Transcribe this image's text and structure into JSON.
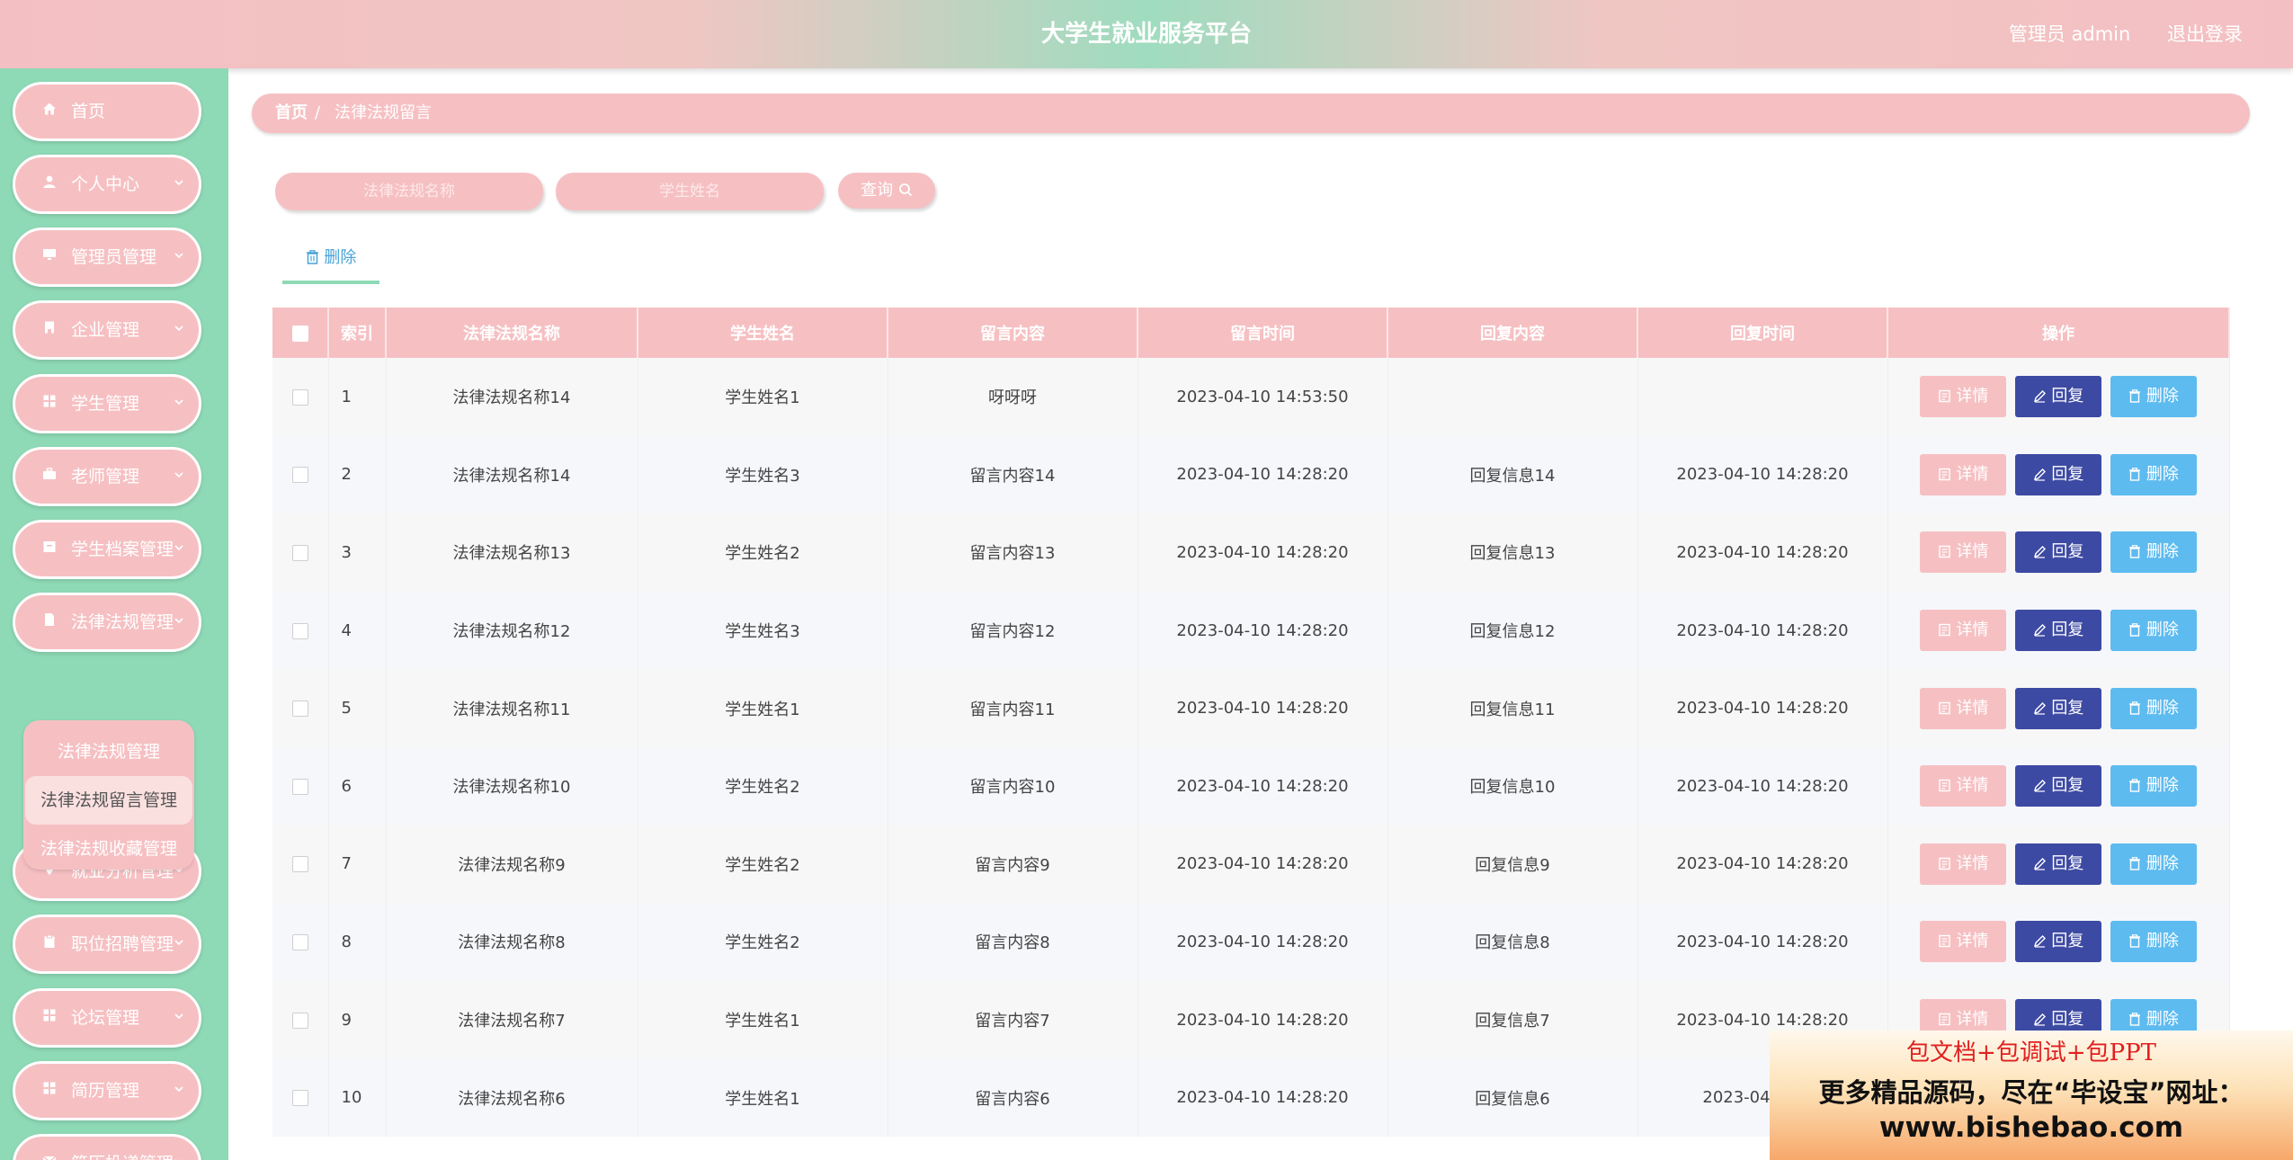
{
  "header": {
    "title": "大学生就业服务平台",
    "admin_label": "管理员 admin",
    "logout_label": "退出登录"
  },
  "sidebar": {
    "items": [
      {
        "label": "首页",
        "icon": "home-icon",
        "has_arrow": false
      },
      {
        "label": "个人中心",
        "icon": "user-icon",
        "has_arrow": true
      },
      {
        "label": "管理员管理",
        "icon": "monitor-icon",
        "has_arrow": true
      },
      {
        "label": "企业管理",
        "icon": "building-icon",
        "has_arrow": true
      },
      {
        "label": "学生管理",
        "icon": "grid-icon",
        "has_arrow": true
      },
      {
        "label": "老师管理",
        "icon": "briefcase-icon",
        "has_arrow": true
      },
      {
        "label": "学生档案管理",
        "icon": "archive-icon",
        "has_arrow": true
      },
      {
        "label": "法律法规管理",
        "icon": "document-icon",
        "has_arrow": true
      },
      {
        "label": "就业分析管理",
        "icon": "location-icon",
        "has_arrow": true
      },
      {
        "label": "职位招聘管理",
        "icon": "clipboard-icon",
        "has_arrow": true
      },
      {
        "label": "论坛管理",
        "icon": "grid-icon",
        "has_arrow": true
      },
      {
        "label": "简历管理",
        "icon": "grid-icon",
        "has_arrow": true
      },
      {
        "label": "简历投递管理",
        "icon": "mail-icon",
        "has_arrow": true
      }
    ],
    "submenu": [
      {
        "label": "法律法规管理"
      },
      {
        "label": "法律法规留言管理"
      },
      {
        "label": "法律法规收藏管理"
      }
    ]
  },
  "breadcrumb": {
    "home": "首页",
    "separator": "/",
    "current": "法律法规留言"
  },
  "search": {
    "name_placeholder": "法律法规名称",
    "student_placeholder": "学生姓名",
    "query_label": "查询"
  },
  "toolbar": {
    "delete_label": "删除"
  },
  "table": {
    "headers": [
      "索引",
      "法律法规名称",
      "学生姓名",
      "留言内容",
      "留言时间",
      "回复内容",
      "回复时间",
      "操作"
    ],
    "rows": [
      {
        "idx": "1",
        "name": "法律法规名称14",
        "student": "学生姓名1",
        "content": "呀呀呀",
        "time": "2023-04-10 14:53:50",
        "reply": "",
        "reply_time": ""
      },
      {
        "idx": "2",
        "name": "法律法规名称14",
        "student": "学生姓名3",
        "content": "留言内容14",
        "time": "2023-04-10 14:28:20",
        "reply": "回复信息14",
        "reply_time": "2023-04-10 14:28:20"
      },
      {
        "idx": "3",
        "name": "法律法规名称13",
        "student": "学生姓名2",
        "content": "留言内容13",
        "time": "2023-04-10 14:28:20",
        "reply": "回复信息13",
        "reply_time": "2023-04-10 14:28:20"
      },
      {
        "idx": "4",
        "name": "法律法规名称12",
        "student": "学生姓名3",
        "content": "留言内容12",
        "time": "2023-04-10 14:28:20",
        "reply": "回复信息12",
        "reply_time": "2023-04-10 14:28:20"
      },
      {
        "idx": "5",
        "name": "法律法规名称11",
        "student": "学生姓名1",
        "content": "留言内容11",
        "time": "2023-04-10 14:28:20",
        "reply": "回复信息11",
        "reply_time": "2023-04-10 14:28:20"
      },
      {
        "idx": "6",
        "name": "法律法规名称10",
        "student": "学生姓名2",
        "content": "留言内容10",
        "time": "2023-04-10 14:28:20",
        "reply": "回复信息10",
        "reply_time": "2023-04-10 14:28:20"
      },
      {
        "idx": "7",
        "name": "法律法规名称9",
        "student": "学生姓名2",
        "content": "留言内容9",
        "time": "2023-04-10 14:28:20",
        "reply": "回复信息9",
        "reply_time": "2023-04-10 14:28:20"
      },
      {
        "idx": "8",
        "name": "法律法规名称8",
        "student": "学生姓名2",
        "content": "留言内容8",
        "time": "2023-04-10 14:28:20",
        "reply": "回复信息8",
        "reply_time": "2023-04-10 14:28:20"
      },
      {
        "idx": "9",
        "name": "法律法规名称7",
        "student": "学生姓名1",
        "content": "留言内容7",
        "time": "2023-04-10 14:28:20",
        "reply": "回复信息7",
        "reply_time": "2023-04-10 14:28:20"
      },
      {
        "idx": "10",
        "name": "法律法规名称6",
        "student": "学生姓名1",
        "content": "留言内容6",
        "time": "2023-04-10 14:28:20",
        "reply": "回复信息6",
        "reply_time": "2023-04-10 14"
      }
    ],
    "actions": {
      "detail": "详情",
      "reply": "回复",
      "delete": "删除"
    }
  },
  "ad": {
    "line1": "包文档+包调试+包PPT",
    "line2": "更多精品源码，尽在“毕设宝”网址：",
    "line3": "www.bishebao.com"
  },
  "colors": {
    "pink": "#f6c0c3",
    "mint": "#8ed9b6",
    "reply_button": "#3d4aa3",
    "delete_button": "#5dbbf0"
  }
}
